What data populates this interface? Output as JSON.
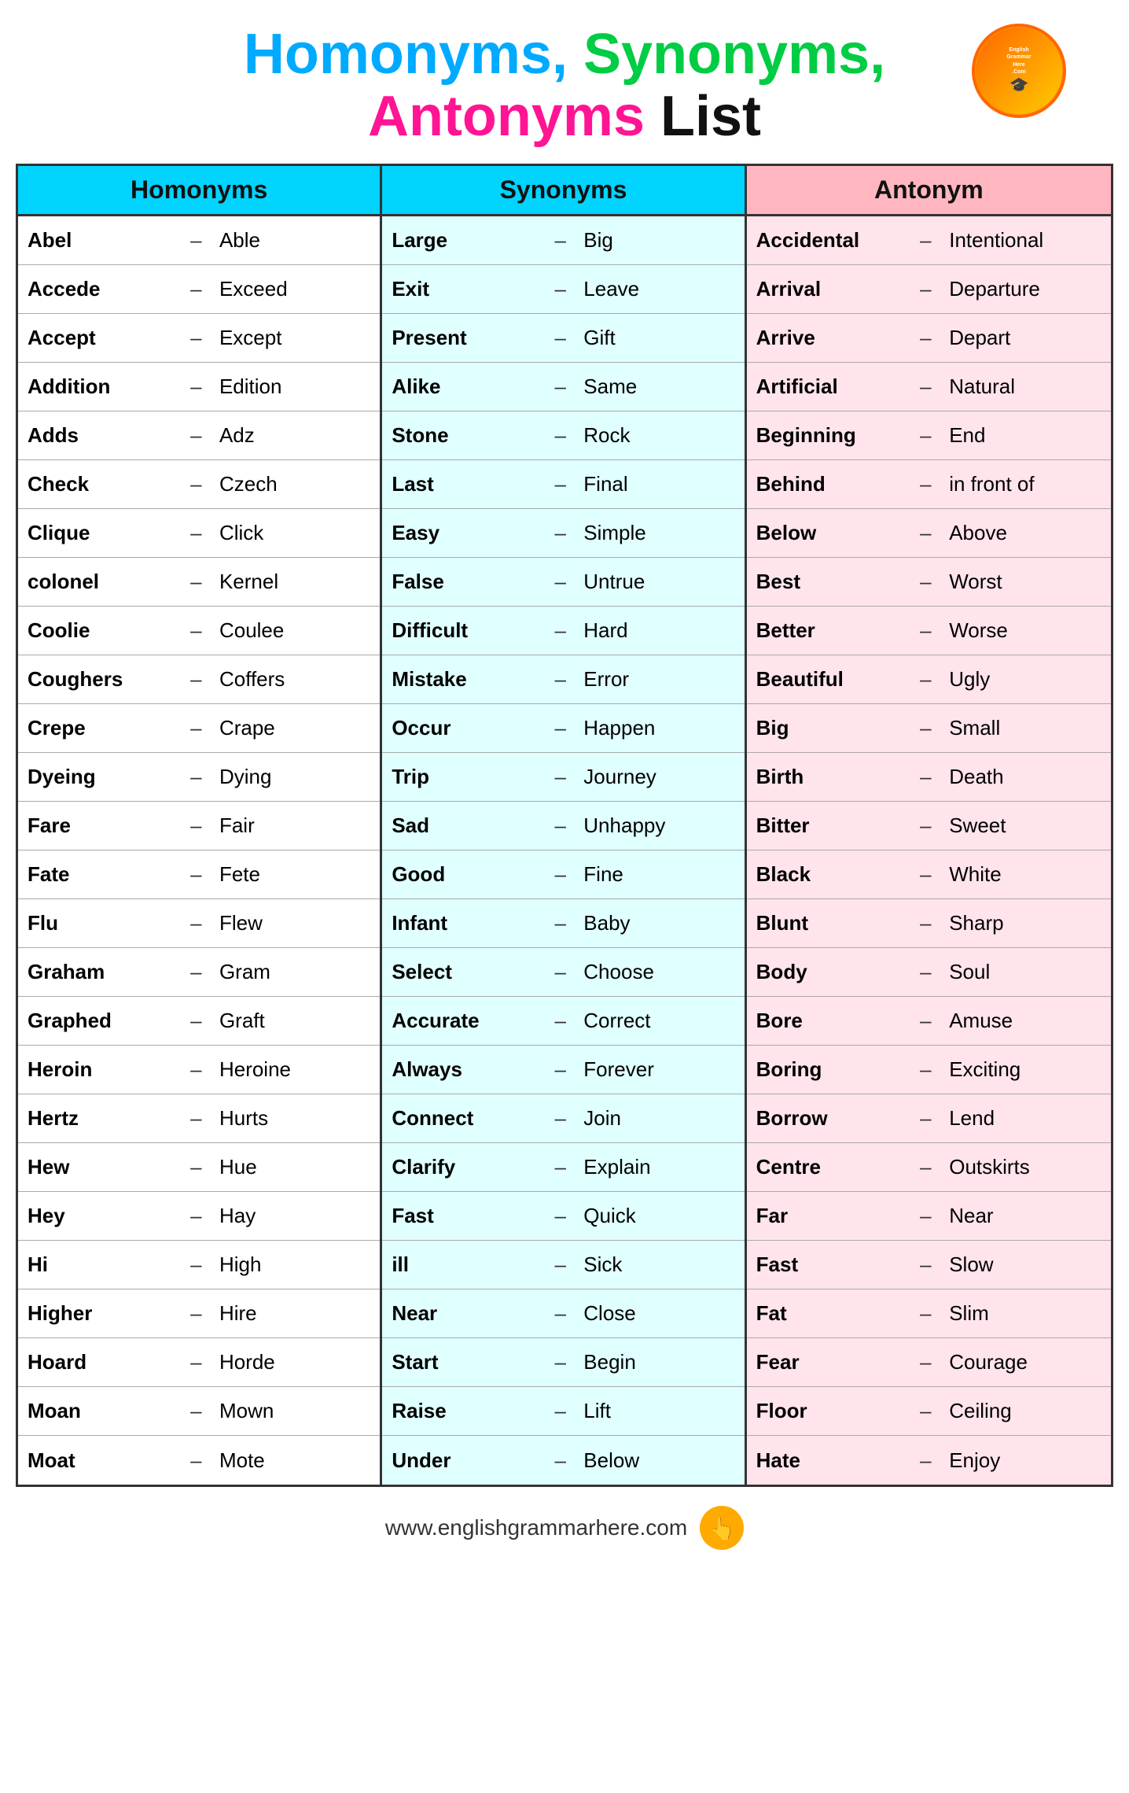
{
  "title": {
    "line1_part1": "Homonyms,",
    "line1_part2": "Synonyms,",
    "line2_part1": "Antonyms",
    "line2_part2": "List"
  },
  "columns": {
    "homonyms": {
      "header": "Homonyms",
      "rows": [
        {
          "word": "Abel",
          "dash": "–",
          "meaning": "Able"
        },
        {
          "word": "Accede",
          "dash": "–",
          "meaning": "Exceed"
        },
        {
          "word": "Accept",
          "dash": "–",
          "meaning": "Except"
        },
        {
          "word": "Addition",
          "dash": "–",
          "meaning": "Edition"
        },
        {
          "word": "Adds",
          "dash": "–",
          "meaning": "Adz"
        },
        {
          "word": "Check",
          "dash": "–",
          "meaning": "Czech"
        },
        {
          "word": "Clique",
          "dash": "–",
          "meaning": "Click"
        },
        {
          "word": "colonel",
          "dash": "–",
          "meaning": "Kernel"
        },
        {
          "word": "Coolie",
          "dash": "–",
          "meaning": "Coulee"
        },
        {
          "word": "Coughers",
          "dash": "–",
          "meaning": "Coffers"
        },
        {
          "word": "Crepe",
          "dash": "–",
          "meaning": "Crape"
        },
        {
          "word": "Dyeing",
          "dash": "–",
          "meaning": "Dying"
        },
        {
          "word": "Fare",
          "dash": "–",
          "meaning": "Fair"
        },
        {
          "word": "Fate",
          "dash": "–",
          "meaning": "Fete"
        },
        {
          "word": "Flu",
          "dash": "–",
          "meaning": "Flew"
        },
        {
          "word": "Graham",
          "dash": "–",
          "meaning": "Gram"
        },
        {
          "word": "Graphed",
          "dash": "–",
          "meaning": "Graft"
        },
        {
          "word": "Heroin",
          "dash": "–",
          "meaning": "Heroine"
        },
        {
          "word": "Hertz",
          "dash": "–",
          "meaning": "Hurts"
        },
        {
          "word": "Hew",
          "dash": "–",
          "meaning": "Hue"
        },
        {
          "word": "Hey",
          "dash": "–",
          "meaning": "Hay"
        },
        {
          "word": "Hi",
          "dash": "–",
          "meaning": "High"
        },
        {
          "word": "Higher",
          "dash": "–",
          "meaning": "Hire"
        },
        {
          "word": "Hoard",
          "dash": "–",
          "meaning": "Horde"
        },
        {
          "word": "Moan",
          "dash": "–",
          "meaning": "Mown"
        },
        {
          "word": "Moat",
          "dash": "–",
          "meaning": "Mote"
        }
      ]
    },
    "synonyms": {
      "header": "Synonyms",
      "rows": [
        {
          "word": "Large",
          "dash": "–",
          "meaning": "Big"
        },
        {
          "word": "Exit",
          "dash": "–",
          "meaning": "Leave"
        },
        {
          "word": "Present",
          "dash": "–",
          "meaning": "Gift"
        },
        {
          "word": "Alike",
          "dash": "–",
          "meaning": "Same"
        },
        {
          "word": "Stone",
          "dash": "–",
          "meaning": "Rock"
        },
        {
          "word": "Last",
          "dash": "–",
          "meaning": "Final"
        },
        {
          "word": "Easy",
          "dash": "–",
          "meaning": "Simple"
        },
        {
          "word": "False",
          "dash": "–",
          "meaning": "Untrue"
        },
        {
          "word": "Difficult",
          "dash": "–",
          "meaning": "Hard"
        },
        {
          "word": "Mistake",
          "dash": "–",
          "meaning": "Error"
        },
        {
          "word": "Occur",
          "dash": "–",
          "meaning": "Happen"
        },
        {
          "word": "Trip",
          "dash": "–",
          "meaning": "Journey"
        },
        {
          "word": "Sad",
          "dash": "–",
          "meaning": "Unhappy"
        },
        {
          "word": "Good",
          "dash": "–",
          "meaning": "Fine"
        },
        {
          "word": "Infant",
          "dash": "–",
          "meaning": "Baby"
        },
        {
          "word": "Select",
          "dash": "–",
          "meaning": "Choose"
        },
        {
          "word": "Accurate",
          "dash": "–",
          "meaning": "Correct"
        },
        {
          "word": "Always",
          "dash": "–",
          "meaning": "Forever"
        },
        {
          "word": "Connect",
          "dash": "–",
          "meaning": "Join"
        },
        {
          "word": "Clarify",
          "dash": "–",
          "meaning": "Explain"
        },
        {
          "word": "Fast",
          "dash": "–",
          "meaning": "Quick"
        },
        {
          "word": "ill",
          "dash": "–",
          "meaning": "Sick"
        },
        {
          "word": "Near",
          "dash": "–",
          "meaning": "Close"
        },
        {
          "word": "Start",
          "dash": "–",
          "meaning": "Begin"
        },
        {
          "word": "Raise",
          "dash": "–",
          "meaning": "Lift"
        },
        {
          "word": "Under",
          "dash": "–",
          "meaning": "Below"
        }
      ]
    },
    "antonyms": {
      "header": "Antonym",
      "rows": [
        {
          "word": "Accidental",
          "dash": "–",
          "meaning": "Intentional"
        },
        {
          "word": "Arrival",
          "dash": "–",
          "meaning": "Departure"
        },
        {
          "word": "Arrive",
          "dash": "–",
          "meaning": "Depart"
        },
        {
          "word": "Artificial",
          "dash": "–",
          "meaning": "Natural"
        },
        {
          "word": "Beginning",
          "dash": "–",
          "meaning": "End"
        },
        {
          "word": "Behind",
          "dash": "–",
          "meaning": "in front of"
        },
        {
          "word": "Below",
          "dash": "–",
          "meaning": "Above"
        },
        {
          "word": "Best",
          "dash": "–",
          "meaning": "Worst"
        },
        {
          "word": "Better",
          "dash": "–",
          "meaning": "Worse"
        },
        {
          "word": "Beautiful",
          "dash": "–",
          "meaning": "Ugly"
        },
        {
          "word": "Big",
          "dash": "–",
          "meaning": "Small"
        },
        {
          "word": "Birth",
          "dash": "–",
          "meaning": "Death"
        },
        {
          "word": "Bitter",
          "dash": "–",
          "meaning": "Sweet"
        },
        {
          "word": "Black",
          "dash": "–",
          "meaning": "White"
        },
        {
          "word": "Blunt",
          "dash": "–",
          "meaning": "Sharp"
        },
        {
          "word": "Body",
          "dash": "–",
          "meaning": "Soul"
        },
        {
          "word": "Bore",
          "dash": "–",
          "meaning": "Amuse"
        },
        {
          "word": "Boring",
          "dash": "–",
          "meaning": "Exciting"
        },
        {
          "word": "Borrow",
          "dash": "–",
          "meaning": "Lend"
        },
        {
          "word": "Centre",
          "dash": "–",
          "meaning": "Outskirts"
        },
        {
          "word": "Far",
          "dash": "–",
          "meaning": "Near"
        },
        {
          "word": "Fast",
          "dash": "–",
          "meaning": "Slow"
        },
        {
          "word": "Fat",
          "dash": "–",
          "meaning": "Slim"
        },
        {
          "word": "Fear",
          "dash": "–",
          "meaning": "Courage"
        },
        {
          "word": "Floor",
          "dash": "–",
          "meaning": "Ceiling"
        },
        {
          "word": "Hate",
          "dash": "–",
          "meaning": "Enjoy"
        }
      ]
    }
  },
  "footer": {
    "url": "www.englishgrammarhere.com"
  }
}
